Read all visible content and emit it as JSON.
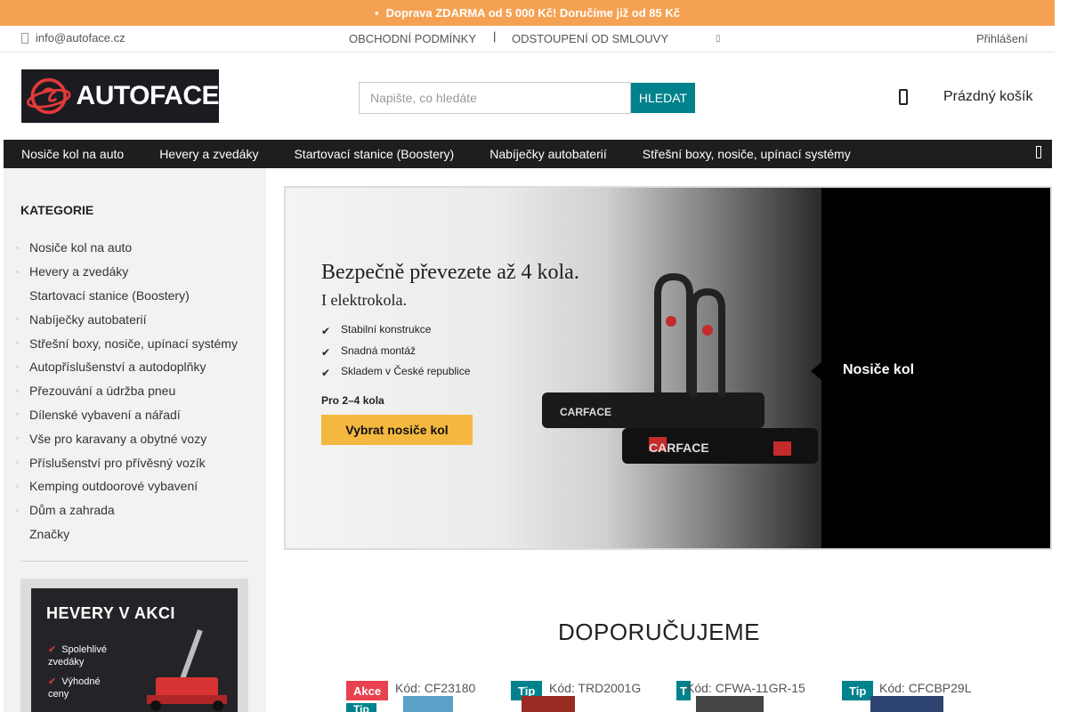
{
  "promo": {
    "text": "Doprava ZDARMA od 5 000 Kč! Doručíme již od 85 Kč",
    "icon": "truck-icon"
  },
  "top_links": {
    "email": "info@autoface.cz",
    "terms": "OBCHODNÍ PODMÍNKY",
    "separator": "|",
    "withdrawal": "ODSTOUPENÍ OD SMLOUVY",
    "login": "Přihlášení"
  },
  "logo": {
    "text": "AUTOFACE"
  },
  "search": {
    "placeholder": "Napište, co hledáte",
    "button": "HLEDAT"
  },
  "cart": {
    "label": "Prázdný košík"
  },
  "nav": {
    "items": [
      "Nosiče kol na auto",
      "Hevery a zvedáky",
      "Startovací stanice (Boostery)",
      "Nabíječky autobaterií",
      "Střešní boxy, nosiče, upínací systémy"
    ]
  },
  "sidebar": {
    "title": "KATEGORIE",
    "items": [
      {
        "label": "Nosiče kol na auto",
        "bullet": true
      },
      {
        "label": "Hevery a zvedáky",
        "bullet": true
      },
      {
        "label": "Startovací stanice (Boostery)",
        "bullet": false
      },
      {
        "label": "Nabíječky autobaterií",
        "bullet": true
      },
      {
        "label": "Střešní boxy, nosiče, upínací systémy",
        "bullet": true
      },
      {
        "label": "Autopříslušenství a autodoplňky",
        "bullet": true
      },
      {
        "label": "Přezouvání a údržba pneu",
        "bullet": true
      },
      {
        "label": "Dílenské vybavení a nářadí",
        "bullet": true
      },
      {
        "label": "Vše pro karavany a obytné vozy",
        "bullet": true
      },
      {
        "label": "Příslušenství pro přívěsný vozík",
        "bullet": true
      },
      {
        "label": "Kemping outdoorové vybavení",
        "bullet": true
      },
      {
        "label": "Dům a zahrada",
        "bullet": true
      },
      {
        "label": "Značky",
        "bullet": false
      }
    ],
    "banner": {
      "title": "HEVERY V AKCI",
      "features": [
        "Spolehlivé zvedáky",
        "Výhodné ceny"
      ]
    }
  },
  "hero": {
    "headline": "Bezpečně převezete až 4 kola.",
    "subline": "I elektrokola.",
    "features": [
      "Stabilní konstrukce",
      "Snadná montáž",
      "Skladem v České republice"
    ],
    "count": "Pro 2–4 kola",
    "cta": "Vybrat nosiče kol",
    "brand": "CARFACE",
    "slide_label": "Nosiče kol"
  },
  "recommend": {
    "title": "DOPORUČUJEME",
    "products": [
      {
        "badge": "Akce",
        "badge_type": "sale",
        "badge2": "Tip",
        "code": "Kód: CF23180"
      },
      {
        "badge": "Tip",
        "badge_type": "tip",
        "badge2": "",
        "code": "Kód: TRD2001G"
      },
      {
        "badge": "T",
        "badge_type": "tip",
        "badge2": "",
        "code": "Kód: CFWA-11GR-15"
      },
      {
        "badge": "Tip",
        "badge_type": "tip",
        "badge2": "",
        "code": "Kód: CFCBP29L"
      }
    ]
  },
  "colors": {
    "promo": "#f5a153",
    "accent": "#00828c",
    "sale": "#e8414f",
    "nav": "#1e1e1e"
  }
}
